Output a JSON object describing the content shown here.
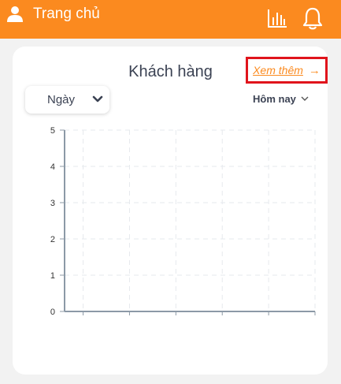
{
  "header": {
    "title": "Trang chủ",
    "bg_color": "#fb8a1f",
    "icons": [
      "user-icon",
      "bar-chart-icon",
      "bell-icon"
    ]
  },
  "card": {
    "title": "Khách hàng",
    "see_more": "Xem thêm",
    "see_more_color": "#fb8a1f",
    "period_select": "Ngày",
    "date_range": "Hôm nay"
  },
  "chart_data": {
    "type": "line",
    "title": "",
    "xlabel": "",
    "ylabel": "",
    "yticks": [
      "0",
      "1",
      "2",
      "3",
      "4",
      "5"
    ],
    "ylim": [
      0,
      5
    ],
    "categories": [
      "",
      "",
      "",
      "",
      "",
      ""
    ],
    "series": [],
    "grid": true
  }
}
